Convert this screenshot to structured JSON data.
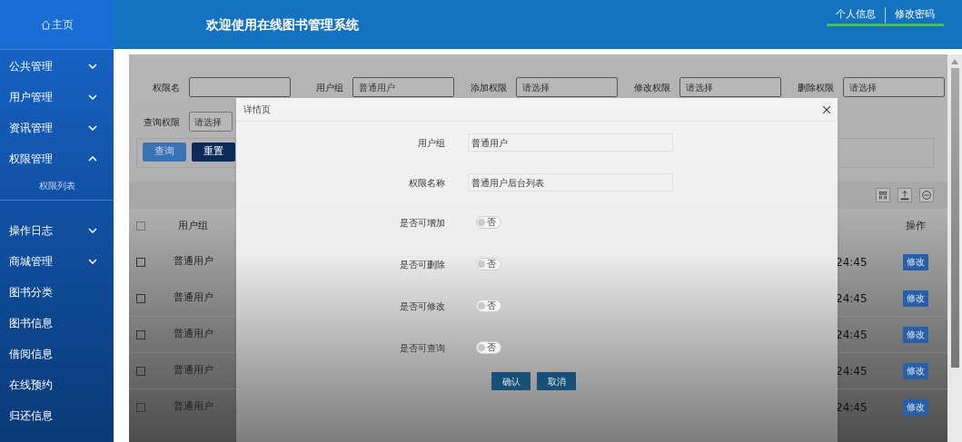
{
  "sidebar": {
    "home": "主页",
    "items": [
      {
        "kind": "group",
        "label": "公共管理",
        "expanded": false
      },
      {
        "kind": "group",
        "label": "用户管理",
        "expanded": false
      },
      {
        "kind": "group",
        "label": "资讯管理",
        "expanded": false
      },
      {
        "kind": "group",
        "label": "权限管理",
        "expanded": true,
        "children": [
          {
            "label": "权限列表"
          }
        ]
      },
      {
        "kind": "group",
        "label": "操作日志",
        "expanded": false
      },
      {
        "kind": "group",
        "label": "商城管理",
        "expanded": false
      },
      {
        "kind": "link",
        "label": "图书分类"
      },
      {
        "kind": "link",
        "label": "图书信息"
      },
      {
        "kind": "link",
        "label": "借阅信息"
      },
      {
        "kind": "link",
        "label": "在线预约"
      },
      {
        "kind": "link",
        "label": "归还信息"
      }
    ]
  },
  "header": {
    "title": "欢迎使用在线图书管理系统",
    "user_links": [
      "个人信息",
      "修改密码"
    ]
  },
  "filters": {
    "rows": [
      [
        {
          "label": "权限名",
          "kind": "text"
        },
        {
          "label": "用户组",
          "kind": "select",
          "value": "普通用户"
        },
        {
          "label": "添加权限",
          "kind": "select",
          "placeholder": "请选择"
        },
        {
          "label": "修改权限",
          "kind": "select",
          "placeholder": "请选择"
        },
        {
          "label": "删除权限",
          "kind": "select",
          "placeholder": "请选择"
        }
      ],
      [
        {
          "label": "查询权限",
          "kind": "select",
          "placeholder": "请选择"
        }
      ]
    ],
    "buttons": [
      {
        "label": "查询",
        "kind": "primary"
      },
      {
        "label": "重置",
        "kind": "dark"
      }
    ]
  },
  "table": {
    "select_all": {
      "checked": false
    },
    "columns": [
      "用户组",
      "操作"
    ],
    "rows": [
      {
        "checked": false,
        "user_group": "普通用户",
        "column_3": "24:45",
        "action": "修改"
      },
      {
        "checked": false,
        "user_group": "普通用户",
        "column_3": "24:45",
        "action": "修改"
      },
      {
        "checked": false,
        "user_group": "普通用户",
        "column_3": "24:45",
        "action": "修改"
      },
      {
        "checked": false,
        "user_group": "普通用户",
        "column_3": "24:45",
        "action": "修改"
      },
      {
        "checked": false,
        "user_group": "普通用户",
        "column_3": "24:45",
        "action": "修改"
      }
    ]
  },
  "modal": {
    "title": "详情页",
    "fields": [
      {
        "kind": "text",
        "label": "用户组",
        "value": "普通用户"
      },
      {
        "kind": "text",
        "label": "权限名称",
        "value": "普通用户后台列表"
      },
      {
        "kind": "toggle",
        "label": "是否可增加",
        "on": false,
        "toggle_label": "否"
      },
      {
        "kind": "toggle",
        "label": "是否可删除",
        "on": false,
        "toggle_label": "否"
      },
      {
        "kind": "toggle",
        "label": "是否可修改",
        "on": false,
        "toggle_label": "否"
      },
      {
        "kind": "toggle",
        "label": "是否可查询",
        "on": false,
        "toggle_label": "否"
      }
    ],
    "buttons": [
      "确认",
      "取消"
    ]
  }
}
